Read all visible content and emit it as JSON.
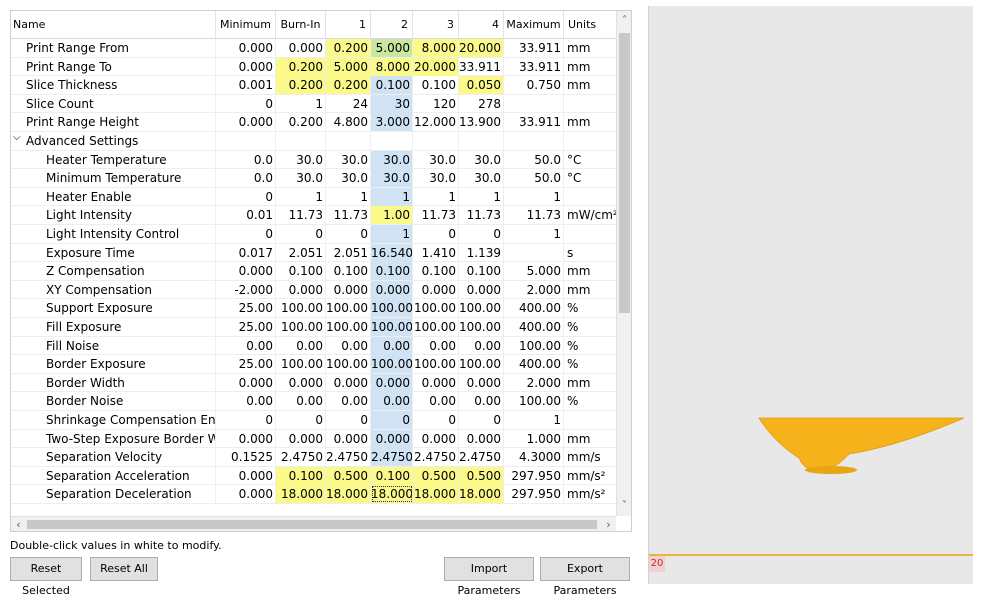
{
  "columns": [
    "Name",
    "Minimum",
    "Burn-In",
    "1",
    "2",
    "3",
    "4",
    "Maximum",
    "Units"
  ],
  "rows": [
    {
      "name": "Print Range From",
      "cells": [
        "0.000",
        "0.000",
        "0.200",
        "5.000",
        "8.000",
        "20.000"
      ],
      "max": "33.911",
      "units": "mm",
      "child": false,
      "hl": [
        "",
        "",
        "y",
        "g",
        "y",
        "y"
      ]
    },
    {
      "name": "Print Range To",
      "cells": [
        "0.000",
        "0.200",
        "5.000",
        "8.000",
        "20.000",
        "33.911"
      ],
      "max": "33.911",
      "units": "mm",
      "child": false,
      "hl": [
        "",
        "y",
        "y",
        "y",
        "y",
        ""
      ]
    },
    {
      "name": "Slice Thickness",
      "cells": [
        "0.001",
        "0.200",
        "0.200",
        "0.100",
        "0.100",
        "0.050"
      ],
      "max": "0.750",
      "units": "mm",
      "child": false,
      "hl": [
        "",
        "y",
        "y",
        "b",
        "",
        "y"
      ]
    },
    {
      "name": "Slice Count",
      "cells": [
        "0",
        "1",
        "24",
        "30",
        "120",
        "278"
      ],
      "max": "",
      "units": "",
      "child": false,
      "hl": [
        "",
        "",
        "",
        "b",
        "",
        ""
      ]
    },
    {
      "name": "Print Range Height",
      "cells": [
        "0.000",
        "0.200",
        "4.800",
        "3.000",
        "12.000",
        "13.900"
      ],
      "max": "33.911",
      "units": "mm",
      "child": false,
      "hl": [
        "",
        "",
        "",
        "b",
        "",
        ""
      ]
    },
    {
      "name": "Advanced Settings",
      "cells": [
        "",
        "",
        "",
        "",
        "",
        ""
      ],
      "max": "",
      "units": "",
      "child": false,
      "group": true,
      "hl": [
        "",
        "",
        "",
        "",
        "",
        ""
      ]
    },
    {
      "name": "Heater Temperature",
      "cells": [
        "0.0",
        "30.0",
        "30.0",
        "30.0",
        "30.0",
        "30.0"
      ],
      "max": "50.0",
      "units": "°C",
      "child": true,
      "hl": [
        "",
        "",
        "",
        "b",
        "",
        ""
      ]
    },
    {
      "name": "Minimum Temperature",
      "cells": [
        "0.0",
        "30.0",
        "30.0",
        "30.0",
        "30.0",
        "30.0"
      ],
      "max": "50.0",
      "units": "°C",
      "child": true,
      "hl": [
        "",
        "",
        "",
        "b",
        "",
        ""
      ]
    },
    {
      "name": "Heater Enable",
      "cells": [
        "0",
        "1",
        "1",
        "1",
        "1",
        "1"
      ],
      "max": "1",
      "units": "",
      "child": true,
      "hl": [
        "",
        "",
        "",
        "b",
        "",
        ""
      ]
    },
    {
      "name": "Light Intensity",
      "cells": [
        "0.01",
        "11.73",
        "11.73",
        "1.00",
        "11.73",
        "11.73"
      ],
      "max": "11.73",
      "units": "mW/cm²",
      "child": true,
      "hl": [
        "",
        "",
        "",
        "y",
        "",
        ""
      ]
    },
    {
      "name": "Light Intensity Control",
      "cells": [
        "0",
        "0",
        "0",
        "1",
        "0",
        "0"
      ],
      "max": "1",
      "units": "",
      "child": true,
      "hl": [
        "",
        "",
        "",
        "b",
        "",
        ""
      ]
    },
    {
      "name": "Exposure Time",
      "cells": [
        "0.017",
        "2.051",
        "2.051",
        "16.540",
        "1.410",
        "1.139"
      ],
      "max": "",
      "units": "s",
      "child": true,
      "hl": [
        "",
        "",
        "",
        "b",
        "",
        ""
      ]
    },
    {
      "name": "Z Compensation",
      "cells": [
        "0.000",
        "0.100",
        "0.100",
        "0.100",
        "0.100",
        "0.100"
      ],
      "max": "5.000",
      "units": "mm",
      "child": true,
      "hl": [
        "",
        "",
        "",
        "b",
        "",
        ""
      ]
    },
    {
      "name": "XY Compensation",
      "cells": [
        "-2.000",
        "0.000",
        "0.000",
        "0.000",
        "0.000",
        "0.000"
      ],
      "max": "2.000",
      "units": "mm",
      "child": true,
      "hl": [
        "",
        "",
        "",
        "b",
        "",
        ""
      ]
    },
    {
      "name": "Support Exposure",
      "cells": [
        "25.00",
        "100.00",
        "100.00",
        "100.00",
        "100.00",
        "100.00"
      ],
      "max": "400.00",
      "units": "%",
      "child": true,
      "hl": [
        "",
        "",
        "",
        "b",
        "",
        ""
      ]
    },
    {
      "name": "Fill Exposure",
      "cells": [
        "25.00",
        "100.00",
        "100.00",
        "100.00",
        "100.00",
        "100.00"
      ],
      "max": "400.00",
      "units": "%",
      "child": true,
      "hl": [
        "",
        "",
        "",
        "b",
        "",
        ""
      ]
    },
    {
      "name": "Fill Noise",
      "cells": [
        "0.00",
        "0.00",
        "0.00",
        "0.00",
        "0.00",
        "0.00"
      ],
      "max": "100.00",
      "units": "%",
      "child": true,
      "hl": [
        "",
        "",
        "",
        "b",
        "",
        ""
      ]
    },
    {
      "name": "Border Exposure",
      "cells": [
        "25.00",
        "100.00",
        "100.00",
        "100.00",
        "100.00",
        "100.00"
      ],
      "max": "400.00",
      "units": "%",
      "child": true,
      "hl": [
        "",
        "",
        "",
        "b",
        "",
        ""
      ]
    },
    {
      "name": "Border Width",
      "cells": [
        "0.000",
        "0.000",
        "0.000",
        "0.000",
        "0.000",
        "0.000"
      ],
      "max": "2.000",
      "units": "mm",
      "child": true,
      "hl": [
        "",
        "",
        "",
        "b",
        "",
        ""
      ]
    },
    {
      "name": "Border Noise",
      "cells": [
        "0.00",
        "0.00",
        "0.00",
        "0.00",
        "0.00",
        "0.00"
      ],
      "max": "100.00",
      "units": "%",
      "child": true,
      "hl": [
        "",
        "",
        "",
        "b",
        "",
        ""
      ]
    },
    {
      "name": "Shrinkage Compensation Enable",
      "cells": [
        "0",
        "0",
        "0",
        "0",
        "0",
        "0"
      ],
      "max": "1",
      "units": "",
      "child": true,
      "hl": [
        "",
        "",
        "",
        "b",
        "",
        ""
      ]
    },
    {
      "name": "Two-Step Exposure Border Width",
      "cells": [
        "0.000",
        "0.000",
        "0.000",
        "0.000",
        "0.000",
        "0.000"
      ],
      "max": "1.000",
      "units": "mm",
      "child": true,
      "hl": [
        "",
        "",
        "",
        "b",
        "",
        ""
      ]
    },
    {
      "name": "Separation Velocity",
      "cells": [
        "0.1525",
        "2.4750",
        "2.4750",
        "2.4750",
        "2.4750",
        "2.4750"
      ],
      "max": "4.3000",
      "units": "mm/s",
      "child": true,
      "hl": [
        "",
        "",
        "",
        "b",
        "",
        ""
      ]
    },
    {
      "name": "Separation Acceleration",
      "cells": [
        "0.000",
        "0.100",
        "0.500",
        "0.100",
        "0.500",
        "0.500"
      ],
      "max": "297.950",
      "units": "mm/s²",
      "child": true,
      "hl": [
        "",
        "y",
        "y",
        "y",
        "y",
        "y"
      ]
    },
    {
      "name": "Separation Deceleration",
      "cells": [
        "0.000",
        "18.000",
        "18.000",
        "18.000",
        "18.000",
        "18.000"
      ],
      "max": "297.950",
      "units": "mm/s²",
      "child": true,
      "hl": [
        "",
        "y",
        "y",
        "ys",
        "y",
        "y"
      ]
    }
  ],
  "hint": "Double-click values in white to modify.",
  "buttons": {
    "reset_selected": "Reset Selected",
    "reset_all": "Reset All",
    "import": "Import Parameters",
    "export": "Export Parameters"
  },
  "viewport": {
    "layer_badge": "20",
    "model_color": "#f5b21a",
    "floor_color": "#e6b445"
  },
  "icons": {
    "expand": "chevron-down-icon",
    "scroll_up": "arrow-up-icon",
    "scroll_down": "arrow-down-icon",
    "scroll_left": "arrow-left-icon",
    "scroll_right": "arrow-right-icon"
  }
}
